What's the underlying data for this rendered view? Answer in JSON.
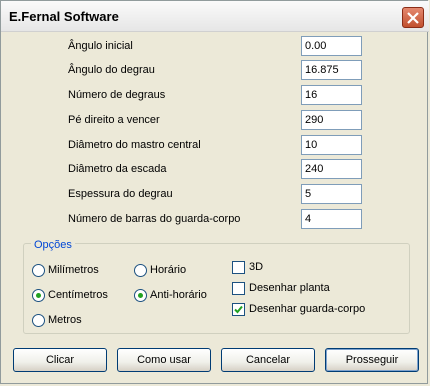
{
  "window": {
    "title": "E.Fernal Software"
  },
  "fields": [
    {
      "label": "Ângulo inicial",
      "value": "0.00"
    },
    {
      "label": "Ângulo do degrau",
      "value": "16.875"
    },
    {
      "label": "Número de degraus",
      "value": "16"
    },
    {
      "label": "Pé direito a vencer",
      "value": "290"
    },
    {
      "label": "Diâmetro do mastro central",
      "value": "10"
    },
    {
      "label": "Diâmetro da escada",
      "value": "240"
    },
    {
      "label": "Espessura do degrau",
      "value": "5"
    },
    {
      "label": "Número de barras do guarda-corpo",
      "value": "4"
    }
  ],
  "options": {
    "legend": "Opções",
    "units": [
      {
        "label": "Milímetros",
        "selected": false
      },
      {
        "label": "Centímetros",
        "selected": true
      },
      {
        "label": "Metros",
        "selected": false
      }
    ],
    "direction": [
      {
        "label": "Horário",
        "selected": false
      },
      {
        "label": "Anti-horário",
        "selected": true
      }
    ],
    "checks": [
      {
        "label": "3D",
        "checked": false
      },
      {
        "label": "Desenhar planta",
        "checked": false
      },
      {
        "label": "Desenhar guarda-corpo",
        "checked": true
      }
    ]
  },
  "buttons": {
    "clicar": "Clicar",
    "como_usar": "Como usar",
    "cancelar": "Cancelar",
    "prosseguir": "Prosseguir"
  }
}
